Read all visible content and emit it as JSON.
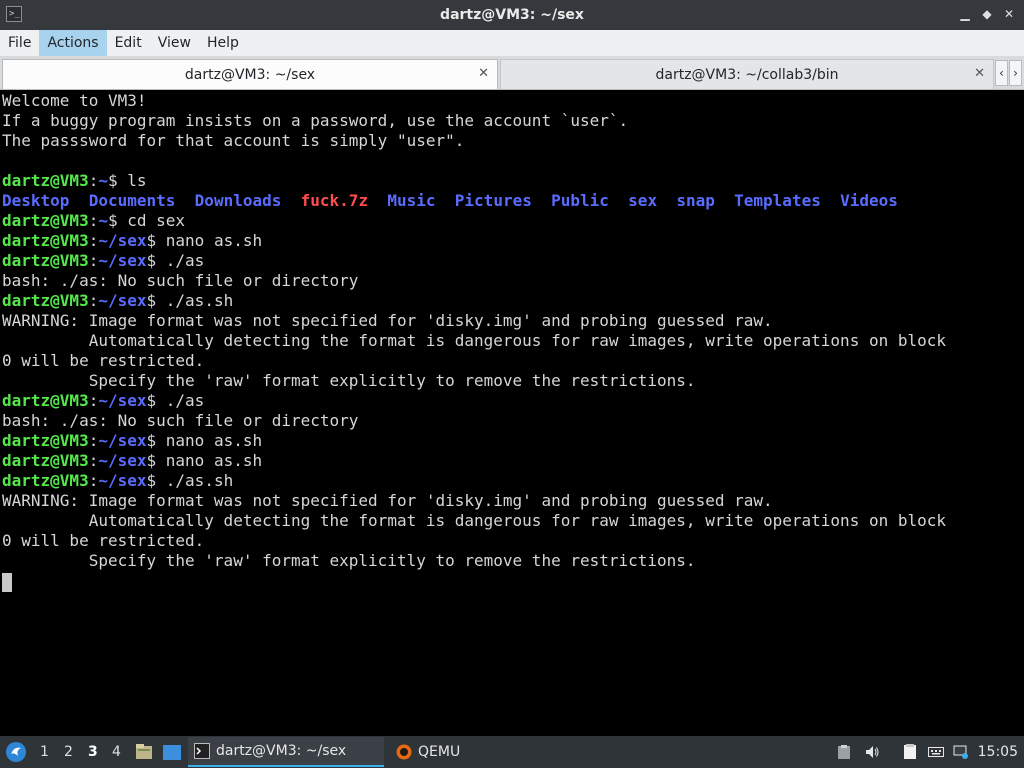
{
  "window": {
    "title": "dartz@VM3: ~/sex",
    "app_icon": ">_",
    "controls": {
      "minimize": "▁",
      "maximize": "◆",
      "close": "✕"
    }
  },
  "menu": [
    "File",
    "Actions",
    "Edit",
    "View",
    "Help"
  ],
  "menu_active": "Actions",
  "tabs": [
    {
      "label": "dartz@VM3: ~/sex",
      "active": true,
      "close": "✕"
    },
    {
      "label": "dartz@VM3: ~/collab3/bin",
      "active": false,
      "close": "✕"
    }
  ],
  "tab_scroll": {
    "left": "‹",
    "right": "›"
  },
  "prompt": {
    "user": "dartz@VM3",
    "sep": ":"
  },
  "terminal_lines": [
    {
      "kind": "text",
      "text": "Welcome to VM3!"
    },
    {
      "kind": "text",
      "text": "If a buggy program insists on a password, use the account `user`."
    },
    {
      "kind": "text",
      "text": "The passsword for that account is simply \"user\"."
    },
    {
      "kind": "text",
      "text": ""
    },
    {
      "kind": "prompt",
      "path": "~",
      "cmd": "ls"
    },
    {
      "kind": "ls",
      "items": [
        {
          "name": "Desktop",
          "type": "dir"
        },
        {
          "name": "Documents",
          "type": "dir"
        },
        {
          "name": "Downloads",
          "type": "dir"
        },
        {
          "name": "fuck.7z",
          "type": "archive"
        },
        {
          "name": "Music",
          "type": "dir"
        },
        {
          "name": "Pictures",
          "type": "dir"
        },
        {
          "name": "Public",
          "type": "dir"
        },
        {
          "name": "sex",
          "type": "dir"
        },
        {
          "name": "snap",
          "type": "dir"
        },
        {
          "name": "Templates",
          "type": "dir"
        },
        {
          "name": "Videos",
          "type": "dir"
        }
      ]
    },
    {
      "kind": "prompt",
      "path": "~",
      "cmd": "cd sex"
    },
    {
      "kind": "prompt",
      "path": "~/sex",
      "cmd": "nano as.sh"
    },
    {
      "kind": "prompt",
      "path": "~/sex",
      "cmd": "./as"
    },
    {
      "kind": "text",
      "text": "bash: ./as: No such file or directory"
    },
    {
      "kind": "prompt",
      "path": "~/sex",
      "cmd": "./as.sh"
    },
    {
      "kind": "text",
      "text": "WARNING: Image format was not specified for 'disky.img' and probing guessed raw."
    },
    {
      "kind": "text",
      "text": "         Automatically detecting the format is dangerous for raw images, write operations on block"
    },
    {
      "kind": "text",
      "text": "0 will be restricted."
    },
    {
      "kind": "text",
      "text": "         Specify the 'raw' format explicitly to remove the restrictions."
    },
    {
      "kind": "prompt",
      "path": "~/sex",
      "cmd": "./as"
    },
    {
      "kind": "text",
      "text": "bash: ./as: No such file or directory"
    },
    {
      "kind": "prompt",
      "path": "~/sex",
      "cmd": "nano as.sh"
    },
    {
      "kind": "prompt",
      "path": "~/sex",
      "cmd": "nano as.sh"
    },
    {
      "kind": "prompt",
      "path": "~/sex",
      "cmd": "./as.sh"
    },
    {
      "kind": "text",
      "text": "WARNING: Image format was not specified for 'disky.img' and probing guessed raw."
    },
    {
      "kind": "text",
      "text": "         Automatically detecting the format is dangerous for raw images, write operations on block"
    },
    {
      "kind": "text",
      "text": "0 will be restricted."
    },
    {
      "kind": "text",
      "text": "         Specify the 'raw' format explicitly to remove the restrictions."
    }
  ],
  "taskbar": {
    "start_icon": "start-menu-icon",
    "workspaces": [
      "1",
      "2",
      "3",
      "4"
    ],
    "active_workspace": "3",
    "tasks": [
      {
        "label": "dartz@VM3: ~/sex",
        "icon": "terminal-icon",
        "active": true
      },
      {
        "label": "QEMU",
        "icon": "qemu-icon",
        "active": false
      }
    ],
    "clock": "15:05"
  },
  "colors": {
    "titlebar": "#35393d",
    "menubar": "#eff0f1",
    "menu_active": "#a8d3ef",
    "terminal_bg": "#000000",
    "terminal_fg": "#d6d6d6",
    "prompt_user": "#54e84a",
    "prompt_path": "#5a6cff",
    "archive": "#ff4d4d",
    "taskbar": "#2f3438"
  }
}
